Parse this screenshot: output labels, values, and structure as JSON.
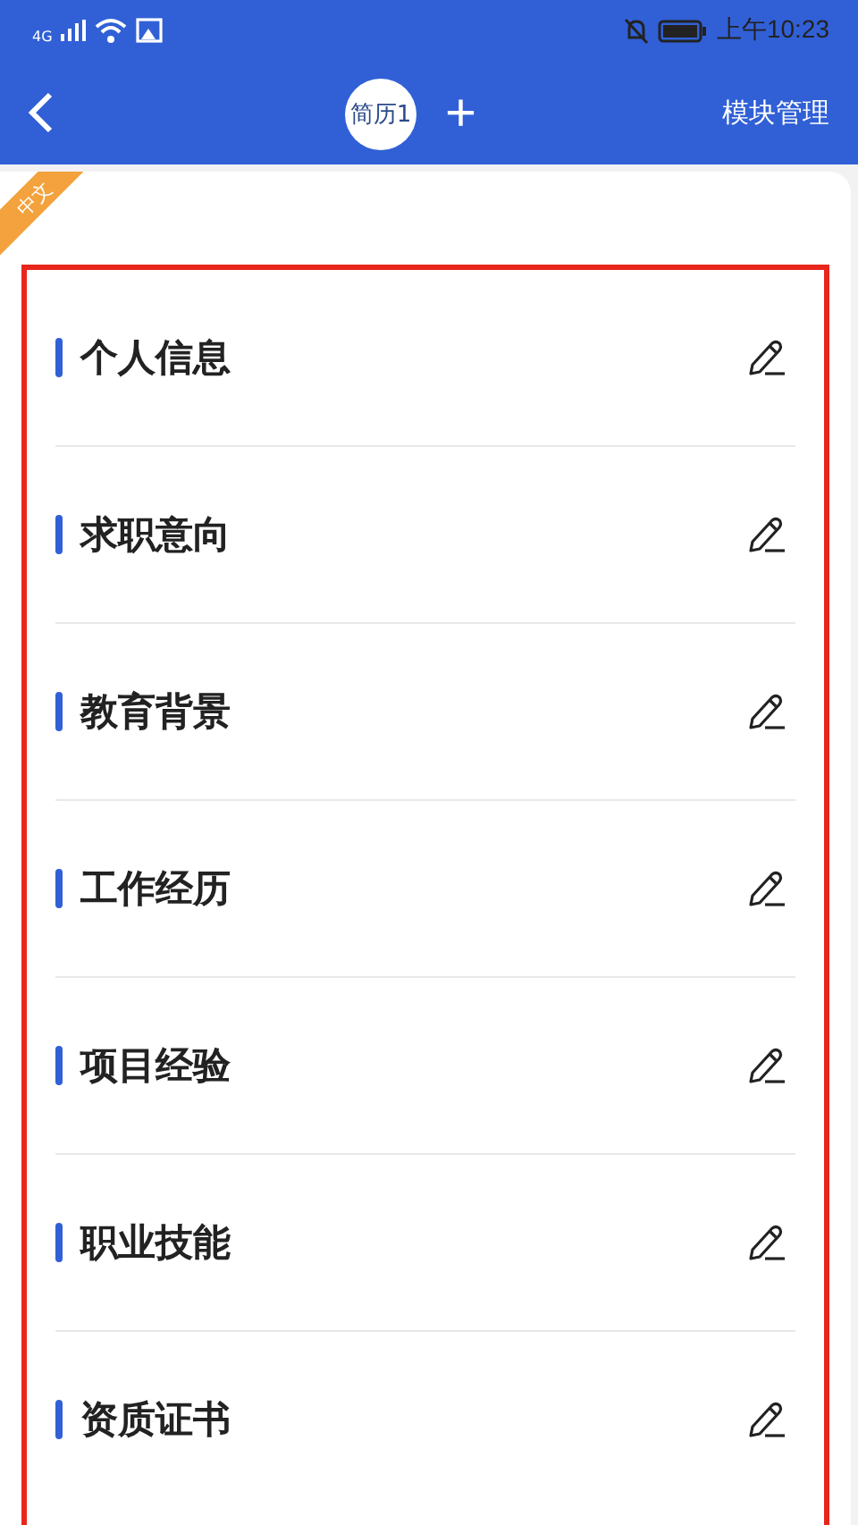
{
  "status_bar": {
    "network": "4G",
    "time": "上午10:23"
  },
  "header": {
    "resume_tab": "简历1",
    "add": "+",
    "manage": "模块管理"
  },
  "ribbon": "中文",
  "sections": [
    {
      "title": "个人信息"
    },
    {
      "title": "求职意向"
    },
    {
      "title": "教育背景"
    },
    {
      "title": "工作经历"
    },
    {
      "title": "项目经验"
    },
    {
      "title": "职业技能"
    },
    {
      "title": "资质证书"
    }
  ]
}
